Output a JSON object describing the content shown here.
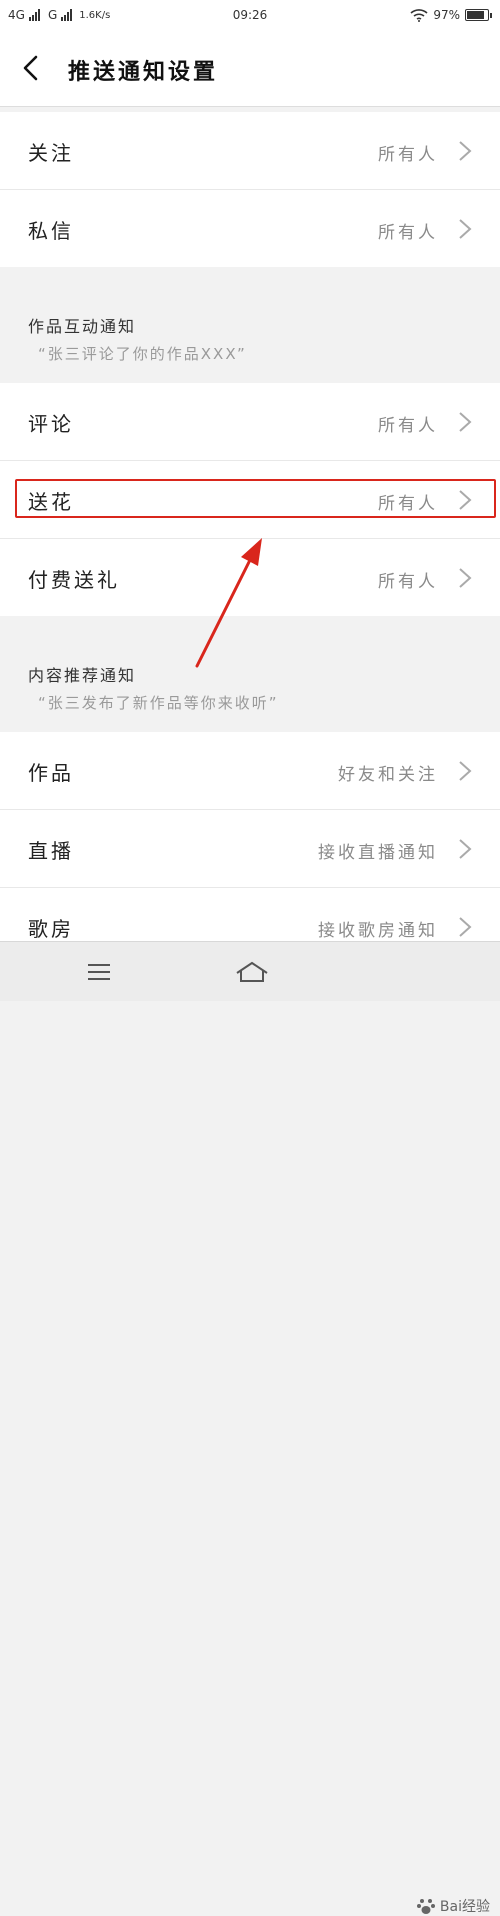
{
  "status_bar": {
    "network1": "4G",
    "network2": "G",
    "speed": "1.6K/s",
    "time": "09:26",
    "battery": "97%"
  },
  "header": {
    "title": "推送通知设置",
    "back_icon": "chevron-left-icon"
  },
  "rows_group1": [
    {
      "label": "关注",
      "value": "所有人"
    },
    {
      "label": "私信",
      "value": "所有人"
    }
  ],
  "section_works": {
    "title": "作品互动通知",
    "desc": "“张三评论了你的作品XXX”"
  },
  "rows_group2": [
    {
      "label": "评论",
      "value": "所有人"
    },
    {
      "label": "送花",
      "value": "所有人"
    },
    {
      "label": "付费送礼",
      "value": "所有人"
    }
  ],
  "section_content": {
    "title": "内容推荐通知",
    "desc": "“张三发布了新作品等你来收听”"
  },
  "rows_group3": [
    {
      "label": "作品",
      "value": "好友和关注"
    },
    {
      "label": "直播",
      "value": "接收直播通知"
    },
    {
      "label": "歌房",
      "value": "接收歌房通知"
    }
  ],
  "watermark": "Bai经验",
  "colors": {
    "highlight": "#d9261c",
    "value_text": "#8a8a8a"
  }
}
